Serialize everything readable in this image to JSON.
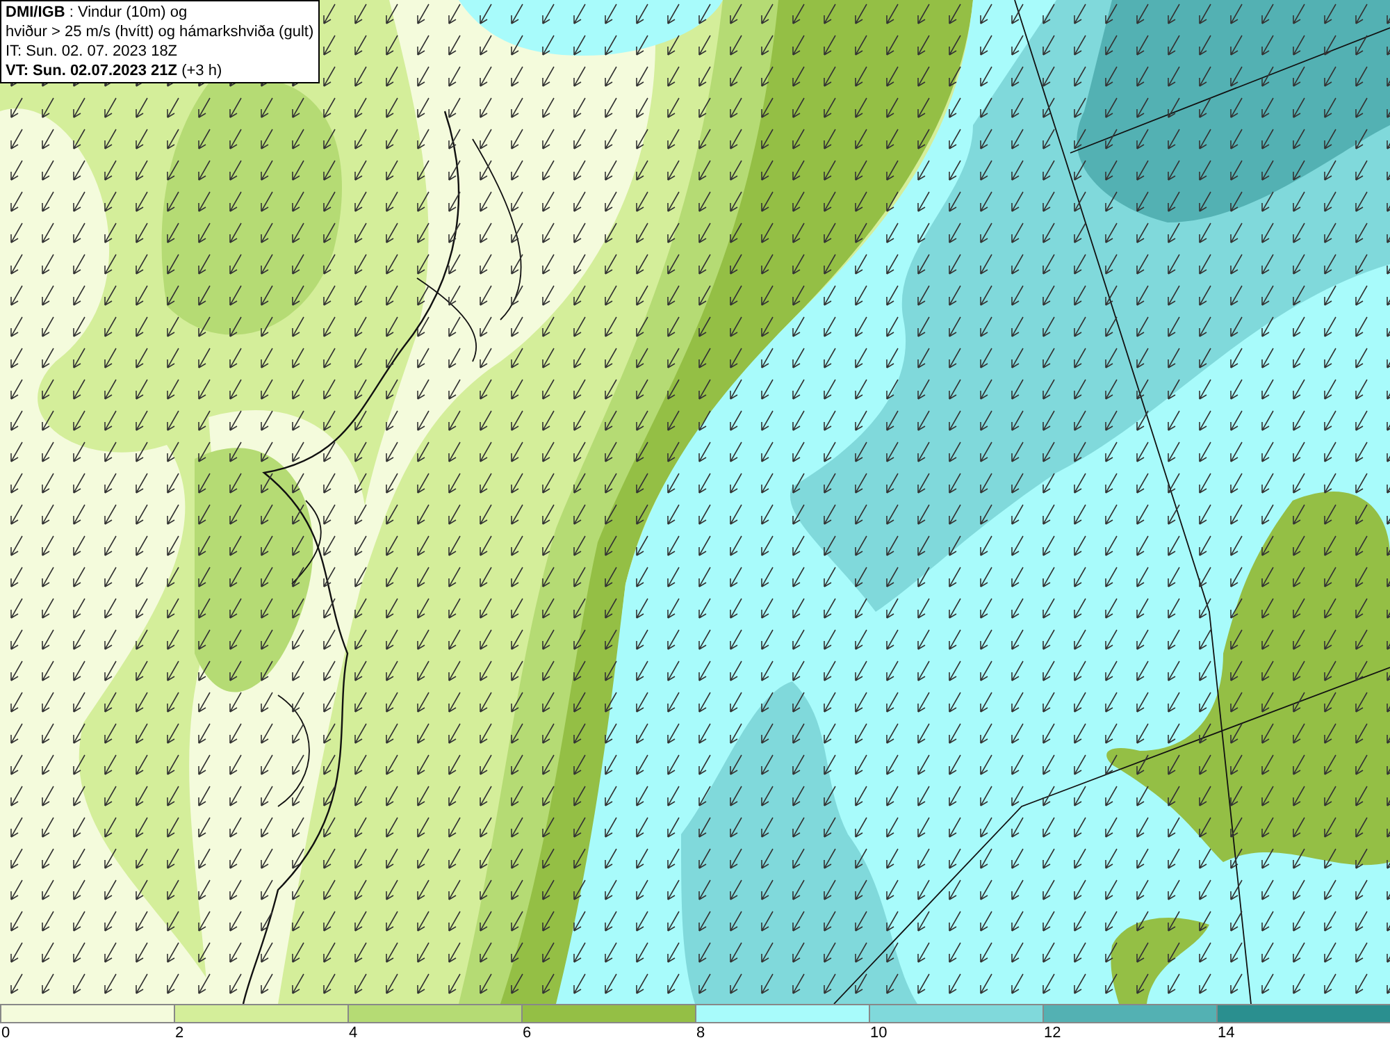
{
  "title_box": {
    "lines": [
      "**DMI/IGB** : Vindur (10m) og",
      "hviður > 25 m/s (hvítt) og hámarkshviða (gult)",
      "IT: Sun. 02. 07. 2023 18Z",
      "**VT: Sun. 02.07.2023 21Z** (+3 h)"
    ]
  },
  "legend": [
    {
      "label": "0",
      "color": "#f4fbdc"
    },
    {
      "label": "2",
      "color": "#d4ee9a"
    },
    {
      "label": "4",
      "color": "#b5db74"
    },
    {
      "label": "6",
      "color": "#94bf45"
    },
    {
      "label": "8",
      "color": "#a8fbfb"
    },
    {
      "label": "10",
      "color": "#80d9db"
    },
    {
      "label": "12",
      "color": "#53b1b3"
    },
    {
      "label": "14",
      "color": "#2a8f8f"
    }
  ]
}
